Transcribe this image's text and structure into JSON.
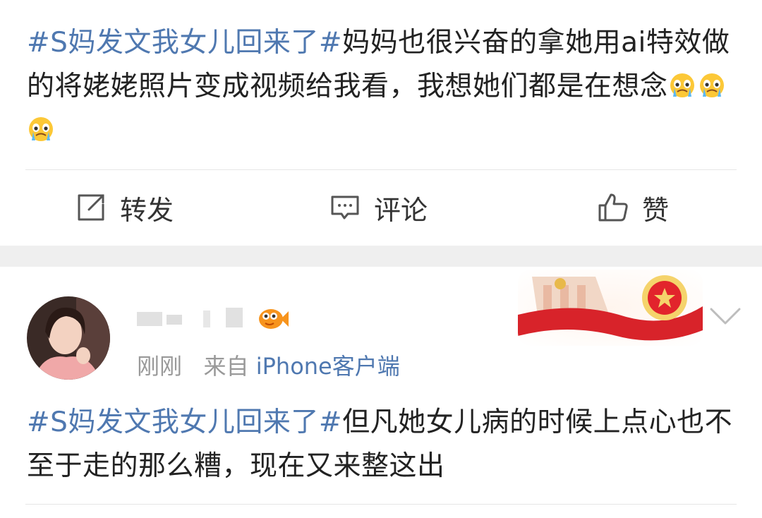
{
  "post1": {
    "topic": "#S妈发文我女儿回来了#",
    "body": "妈妈也很兴奋的拿她用ai特效做的将姥姥照片变成视频给我看，我想她们都是在想念",
    "emoji_icon": "crying-face-icon",
    "actions": {
      "repost_label": "转发",
      "comment_label": "评论",
      "like_label": "赞"
    }
  },
  "post2": {
    "username": "",
    "badge_icon": "fish-badge-icon",
    "time": "刚刚",
    "source_prefix": "来自",
    "source": "iPhone客户端",
    "topic": "#S妈发文我女儿回来了#",
    "body": "但凡她女儿病的时候上点心也不至于走的那么糟，现在又来整这出"
  },
  "colors": {
    "topic": "#4f78b0",
    "text": "#222222",
    "meta": "#999999",
    "separator": "#efefef"
  }
}
